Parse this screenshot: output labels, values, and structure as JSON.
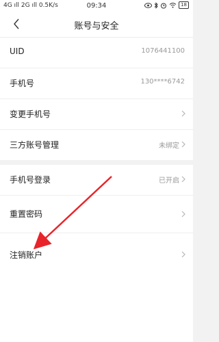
{
  "status_bar": {
    "signal": "4G ıll 2G ıll 0.5K/s",
    "time": "09:34",
    "battery": "18"
  },
  "header": {
    "title": "账号与安全"
  },
  "section1": [
    {
      "label": "UID",
      "value": "1076441100",
      "chevron": false
    },
    {
      "label": "手机号",
      "value": "130****6742",
      "chevron": false
    },
    {
      "label": "变更手机号",
      "value": "",
      "chevron": true
    },
    {
      "label": "三方账号管理",
      "value": "未绑定",
      "chevron": true
    }
  ],
  "section2": [
    {
      "label": "手机号登录",
      "value": "已开启",
      "chevron": true
    },
    {
      "label": "重置密码",
      "value": "",
      "chevron": true
    },
    {
      "label": "注销账户",
      "value": "",
      "chevron": true
    }
  ],
  "colors": {
    "annotation_arrow": "#e8242a"
  },
  "icons": {
    "back": "back-arrow-icon",
    "chevron": "chevron-right-icon"
  }
}
